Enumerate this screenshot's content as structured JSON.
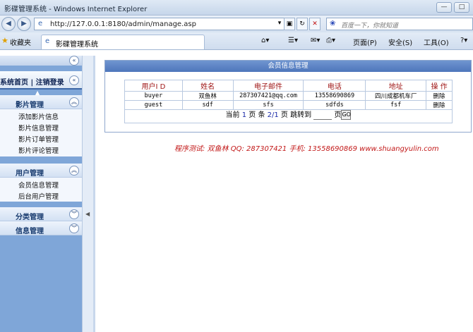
{
  "window": {
    "title": "影碟管理系统 - Windows Internet Explorer",
    "min": "—",
    "max": "□"
  },
  "address": {
    "url": "http://127.0.0.1:8180/admin/manage.asp",
    "search_placeholder": "百度一下，你就知道"
  },
  "toolbar": {
    "favorites": "收藏夹",
    "tab_title": "影碟管理系统",
    "page_menu": "页面(P)",
    "safety_menu": "安全(S)",
    "tools_menu": "工具(O)"
  },
  "sidebar": {
    "header": "系统首页 | 注销登录",
    "groups": [
      {
        "title": "影片管理",
        "items": [
          "添加影片信息",
          "影片信息管理",
          "影片订单管理",
          "影片评论管理"
        ]
      },
      {
        "title": "用户管理",
        "items": [
          "会员信息管理",
          "后台用户管理"
        ]
      },
      {
        "title": "分类管理",
        "items": []
      },
      {
        "title": "信息管理",
        "items": []
      }
    ]
  },
  "panel": {
    "title": "会员信息管理",
    "columns": [
      "用户I D",
      "姓名",
      "电子邮件",
      "电话",
      "地址",
      "操 作"
    ],
    "rows": [
      [
        "buyer",
        "双鱼林",
        "287307421@qq.com",
        "13558690869",
        "四川成都机车厂",
        "删除"
      ],
      [
        "guest",
        "sdf",
        "sfs",
        "sdfds",
        "fsf",
        "删除"
      ]
    ]
  },
  "pager": {
    "label_current": "当前",
    "page": "1",
    "label_page": "页",
    "label_total": "条",
    "total": "2/1",
    "label_jump": "跳转到",
    "go": "GO"
  },
  "footer": {
    "text": "程序测试: 双鱼林  QQ: 287307421  手机: 13558690869  www.shuangyulin.com"
  }
}
